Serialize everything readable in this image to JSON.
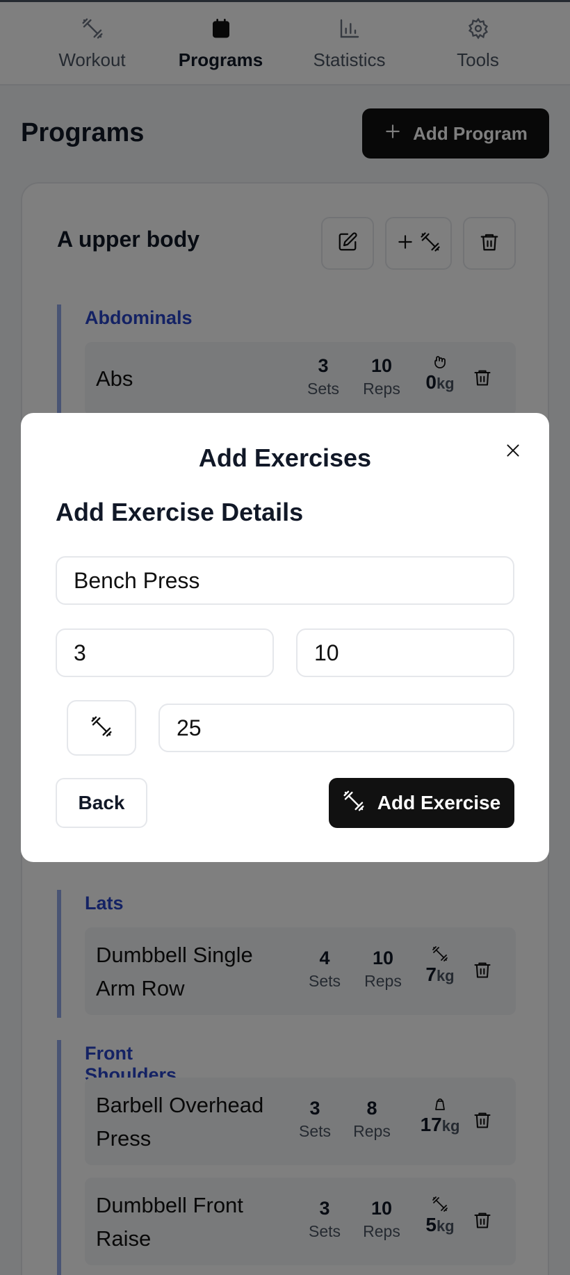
{
  "nav": {
    "items": [
      {
        "label": "Workout",
        "icon": "dumbbell-icon",
        "active": false
      },
      {
        "label": "Programs",
        "icon": "calendar-icon",
        "active": true
      },
      {
        "label": "Statistics",
        "icon": "bar-chart-icon",
        "active": false
      },
      {
        "label": "Tools",
        "icon": "gear-icon",
        "active": false
      }
    ]
  },
  "header": {
    "title": "Programs",
    "add_program_label": "Add Program"
  },
  "program": {
    "name": "A upper body",
    "groups": [
      {
        "title": "Abdominals",
        "exercises": [
          {
            "name": "Abs",
            "sets": "3",
            "sets_label": "Sets",
            "reps": "10",
            "reps_label": "Reps",
            "weight": "0",
            "unit": "kg",
            "equipment_icon": "hand-grip-icon"
          }
        ]
      },
      {
        "title": "Lats",
        "exercises": [
          {
            "name": "Dumbbell Single Arm Row",
            "sets": "4",
            "sets_label": "Sets",
            "reps": "10",
            "reps_label": "Reps",
            "weight": "7",
            "unit": "kg",
            "equipment_icon": "dumbbell-icon"
          }
        ]
      },
      {
        "title": "Front Shoulders",
        "exercises": [
          {
            "name": "Barbell Overhead Press",
            "sets": "3",
            "sets_label": "Sets",
            "reps": "8",
            "reps_label": "Reps",
            "weight": "17",
            "unit": "kg",
            "equipment_icon": "kettlebell-icon"
          },
          {
            "name": "Dumbbell Front Raise",
            "sets": "3",
            "sets_label": "Sets",
            "reps": "10",
            "reps_label": "Reps",
            "weight": "5",
            "unit": "kg",
            "equipment_icon": "dumbbell-icon"
          }
        ]
      }
    ]
  },
  "modal": {
    "title": "Add Exercises",
    "subtitle": "Add Exercise Details",
    "exercise_name": "Bench Press",
    "sets": "3",
    "reps": "10",
    "weight": "25",
    "equipment_icon": "dumbbell-icon",
    "back_label": "Back",
    "add_label": "Add Exercise"
  },
  "colors": {
    "accent": "#111111",
    "group_title": "#2845c9",
    "group_bar": "#93a8e8"
  }
}
